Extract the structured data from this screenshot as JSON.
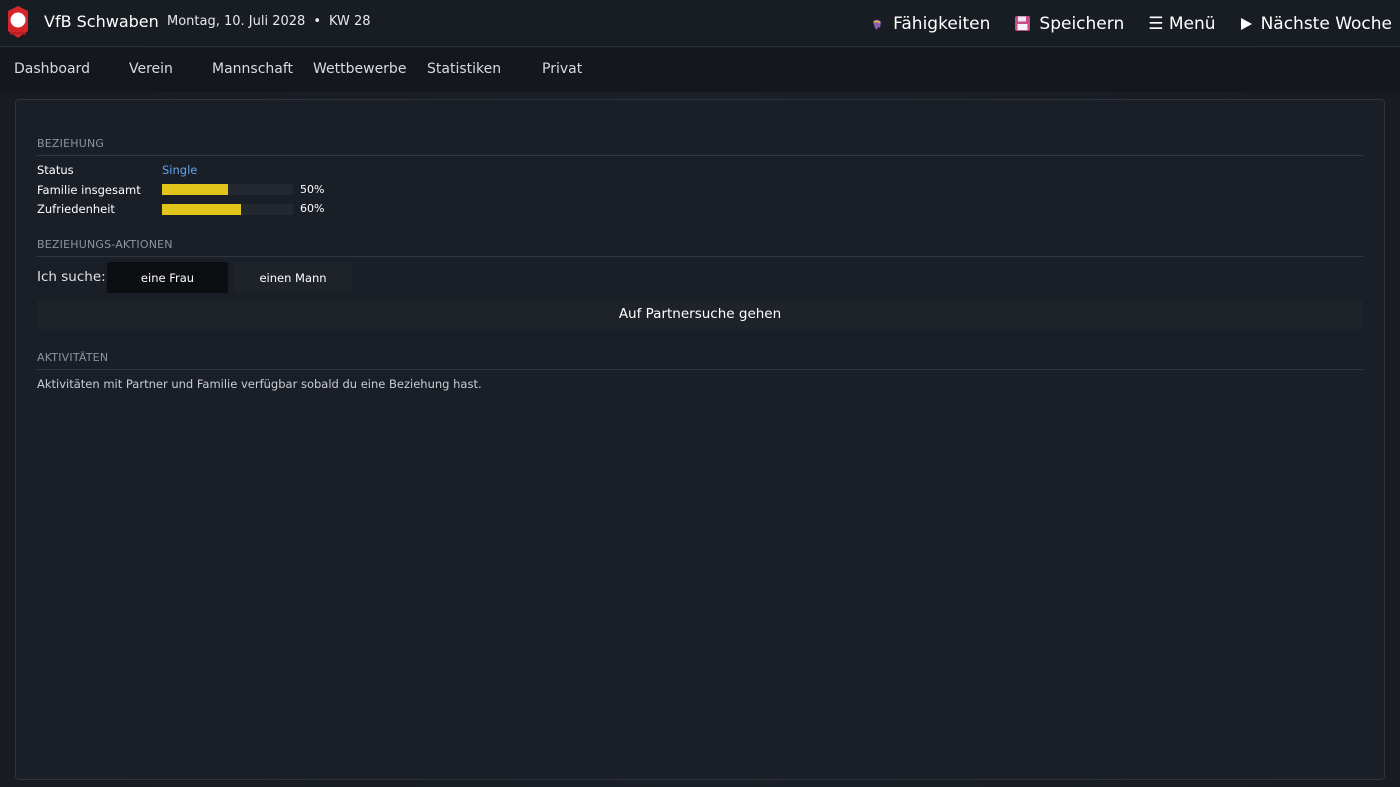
{
  "header": {
    "club_name": "VfB Schwaben",
    "date": "Montag, 10. Juli 2028",
    "separator": "•",
    "week": "KW 28",
    "actions": {
      "skills": "Fähigkeiten",
      "save": "Speichern",
      "menu": "☰ Menü",
      "next_week": "Nächste Woche"
    },
    "icons": {
      "logo": "club-crest-icon",
      "skills": "brain-icon",
      "save": "floppy-disk-icon",
      "next_week": "play-icon"
    }
  },
  "nav": {
    "items": [
      "Dashboard",
      "Verein",
      "Mannschaft",
      "Wettbewerbe",
      "Statistiken",
      "Privat"
    ]
  },
  "relationship": {
    "heading": "BEZIEHUNG",
    "status_label": "Status",
    "status_value": "Single",
    "family_label": "Familie insgesamt",
    "family_value": 0.5,
    "family_pct": "50%",
    "satisfaction_label": "Zufriedenheit",
    "satisfaction_value": 0.6,
    "satisfaction_pct": "60%"
  },
  "actions": {
    "heading": "BEZIEHUNGS-AKTIONEN",
    "search_label": "Ich suche:",
    "option_woman": "eine Frau",
    "option_man": "einen Mann",
    "selected": "eine Frau",
    "go_button": "Auf Partnersuche gehen"
  },
  "activities": {
    "heading": "AKTIVITÄTEN",
    "text": "Aktivitäten mit Partner und Familie verfügbar sobald du eine Beziehung hast."
  },
  "colors": {
    "accent_bar": "#e1c51a",
    "status_blue": "#5fa5f0",
    "logo_red": "#d3262b"
  }
}
